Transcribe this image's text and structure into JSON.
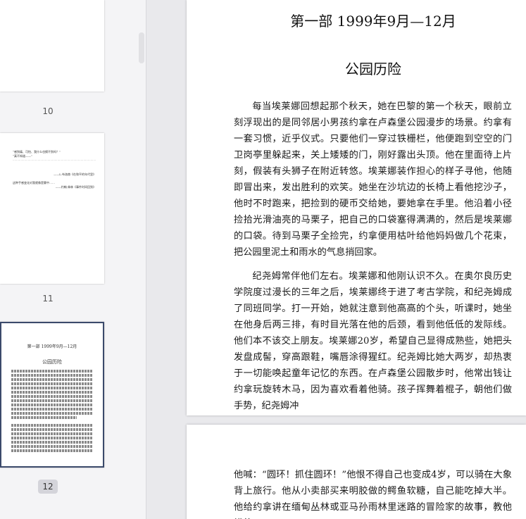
{
  "sidebar": {
    "pages": [
      {
        "number": "10"
      },
      {
        "number": "11",
        "lines": [
          "“感到痛、可怕、我什么也摸不到吗？”",
          "“真不知道——”",
          "——L.布洛赫《在和平的年代里》",
          "这种手感变化对我就像是雾中……",
          "——约翰·弗林《事件时间回到》"
        ]
      },
      {
        "number": "12",
        "part_title": "第一部  1999年9月—12月",
        "chapter": "公园历险"
      }
    ]
  },
  "page": {
    "part_title": "第一部  1999年9月—12月",
    "chapter_title": "公园历险",
    "paragraphs": [
      "每当埃莱娜回想起那个秋天，她在巴黎的第一个秋天，眼前立刻浮现出的是同邻居小男孩约拿在卢森堡公园漫步的场景。约拿有一套习惯，近乎仪式。只要他们一穿过铁栅栏，他便跑到空空的门卫岗亭里躲起来，关上矮矮的门，刚好露出头顶。他在里面待上片刻，假装有头狮子在附近转悠。埃莱娜装作担心的样子寻他，他随即冒出来，发出胜利的欢笑。她坐在沙坑边的长椅上看他挖沙子，他时不时跑来，把捡到的硬币交给她，要她拿在手里。他沿着小径捡拾光滑油亮的马栗子，把自己的口袋塞得满满的，然后是埃莱娜的口袋。待到马栗子全捡完，约拿便用枯叶给他妈妈做几个花束，把公园里泥土和雨水的气息捎回家。",
      "纪尧姆常伴他们左右。埃莱娜和他刚认识不久。在奥尔良历史学院度过漫长的三年之后，埃莱娜终于进了考古学院，和纪尧姆成了同班同学。打一开始，她就注意到他高高的个头，听课时，她坐在他身后两三排，有时目光落在他的后颈，看到他低低的发际线。他们本不该交上朋友。埃莱娜20岁，希望自己显得成熟些，她把头发盘成髻，穿高跟鞋，嘴唇涂得猩红。纪尧姆比她大两岁，却热衷于一切能唤起童年记忆的东西。在卢森堡公园散步时，他常出钱让约拿玩旋转木马，因为喜欢看着他骑。孩子挥舞着棍子，朝他们做手势，纪尧姆冲"
    ],
    "next_page_text": "他喊：“圆环！抓住圆环！”他恨不得自己也变成4岁，可以骑在大象背上旅行。他从小卖部买来明胶做的鳄鱼软糖，自己能吃掉大半。他给约拿讲在缅甸丛林或亚马孙雨林里迷路的冒险家的故事，教他模仿"
  }
}
